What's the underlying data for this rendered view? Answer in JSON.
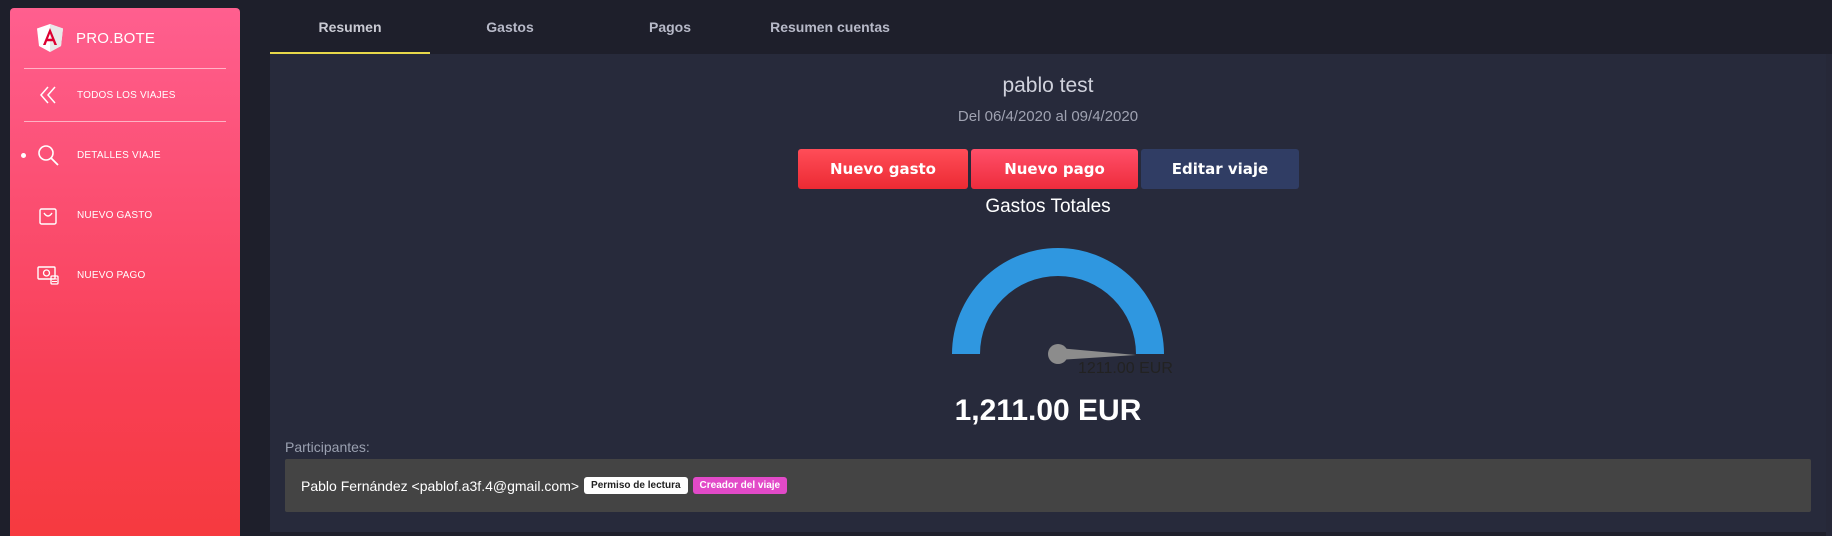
{
  "brand": {
    "name": "PRO.BOTE"
  },
  "sidebar": {
    "items": [
      {
        "label": "TODOS LOS VIAJES",
        "icon": "double-chevron-left-icon"
      },
      {
        "label": "DETALLES VIAJE",
        "icon": "search-icon",
        "active": true
      },
      {
        "label": "NUEVO GASTO",
        "icon": "shopping-bag-icon"
      },
      {
        "label": "NUEVO PAGO",
        "icon": "money-icon"
      }
    ]
  },
  "tabs": [
    {
      "label": "Resumen",
      "active": true
    },
    {
      "label": "Gastos"
    },
    {
      "label": "Pagos"
    },
    {
      "label": "Resumen cuentas"
    }
  ],
  "trip": {
    "title": "pablo test",
    "dates": "Del 06/4/2020 al 09/4/2020"
  },
  "actions": {
    "new_expense": "Nuevo gasto",
    "new_payment": "Nuevo pago",
    "edit_trip": "Editar viaje"
  },
  "summary": {
    "label": "Gastos Totales",
    "gauge_value_label": "1211.00 EUR",
    "gauge_fraction": 1.0,
    "total": "1,211.00 EUR"
  },
  "participants": {
    "label": "Participantes:",
    "items": [
      {
        "name": "Pablo Fernández <pablof.a3f.4@gmail.com>",
        "badges": [
          "Permiso de lectura",
          "Creador del viaje"
        ]
      }
    ]
  },
  "colors": {
    "accent_tab": "#e7d84a",
    "gauge": "#2f97e0",
    "sidebar_top": "#ff5f8f",
    "sidebar_bottom": "#f63a3f"
  }
}
